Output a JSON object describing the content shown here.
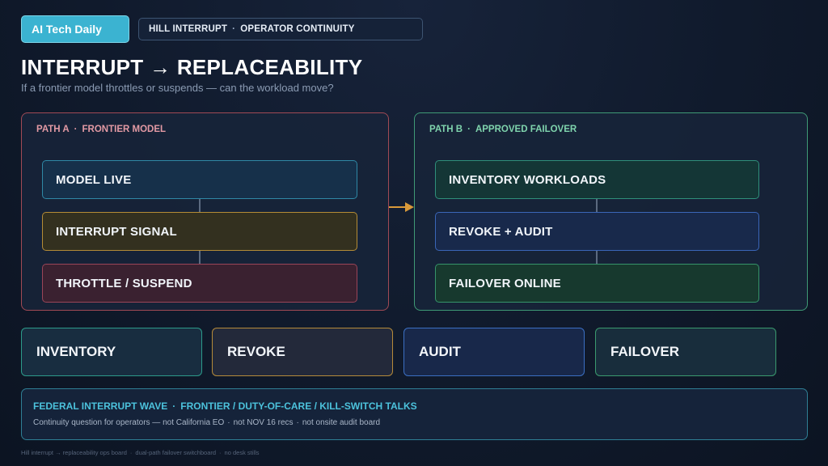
{
  "header": {
    "brand": "AI Tech Daily",
    "tagline_left": "HILL INTERRUPT",
    "tagline_sep": "·",
    "tagline_right": "OPERATOR CONTINUITY"
  },
  "title": "INTERRUPT → REPLACEABILITY",
  "subtitle": "If a frontier model throttles or suspends — can the workload move?",
  "path_a": {
    "label_left": "PATH A",
    "label_sep": "·",
    "label_right": "FRONTIER MODEL",
    "steps": [
      "MODEL LIVE",
      "INTERRUPT SIGNAL",
      "THROTTLE / SUSPEND"
    ]
  },
  "path_b": {
    "label_left": "PATH B",
    "label_sep": "·",
    "label_right": "APPROVED FAILOVER",
    "steps": [
      "INVENTORY WORKLOADS",
      "REVOKE + AUDIT",
      "FAILOVER ONLINE"
    ]
  },
  "tiles": [
    "INVENTORY",
    "REVOKE",
    "AUDIT",
    "FAILOVER"
  ],
  "footer": {
    "head_left": "FEDERAL INTERRUPT WAVE",
    "head_sep": "·",
    "head_right": "FRONTIER / DUTY-OF-CARE / KILL-SWITCH TALKS",
    "body_1": "Continuity question for operators — not California EO",
    "body_sep": "·",
    "body_2": "not NOV 16 recs",
    "body_3": "not onsite audit board"
  },
  "credit": {
    "part_1": "Hill interrupt → replaceability ops board",
    "sep": "·",
    "part_2": "dual-path failover switchboard",
    "part_3": "no desk stills"
  },
  "colors": {
    "accent_cyan": "#3bb3d1",
    "path_a": "#a14a55",
    "path_b": "#3f9a76",
    "arrow": "#d99a3a"
  }
}
